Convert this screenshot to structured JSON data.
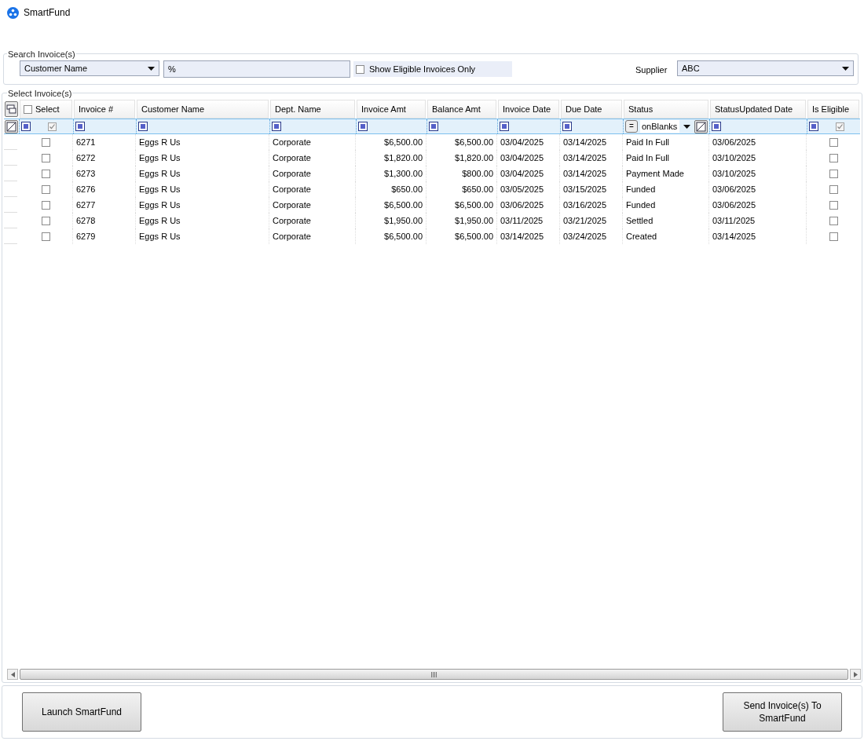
{
  "window": {
    "title": "SmartFund"
  },
  "search": {
    "title": "Search Invoice(s)",
    "field": "Customer Name",
    "value": "%",
    "eligible_only": {
      "label": "Show Eligible Invoices Only",
      "checked": false
    },
    "supplier_label": "Supplier",
    "supplier": "ABC"
  },
  "grid": {
    "title": "Select Invoice(s)",
    "select_all": {
      "label": "Select",
      "checked": false
    },
    "columns": [
      {
        "label": "Invoice #",
        "kind": "text"
      },
      {
        "label": "Customer Name",
        "kind": "text"
      },
      {
        "label": "Dept. Name",
        "kind": "text"
      },
      {
        "label": "Invoice Amt",
        "kind": "amount"
      },
      {
        "label": "Balance Amt",
        "kind": "amount"
      },
      {
        "label": "Invoice Date",
        "kind": "text"
      },
      {
        "label": "Due Date",
        "kind": "text"
      },
      {
        "label": "Status",
        "kind": "text"
      },
      {
        "label": "StatusUpdated Date",
        "kind": "text"
      }
    ],
    "eligible_label": "Is Eligible",
    "filter": {
      "select_checked": true,
      "status_operator": "=",
      "status_text": "onBlanks",
      "eligible_checked": true
    },
    "rows": [
      {
        "selected": false,
        "cells": [
          "6271",
          "Eggs R Us",
          "Corporate",
          "$6,500.00",
          "$6,500.00",
          "03/04/2025",
          "03/14/2025",
          "Paid In Full",
          "03/06/2025"
        ],
        "eligible": false
      },
      {
        "selected": false,
        "cells": [
          "6272",
          "Eggs R Us",
          "Corporate",
          "$1,820.00",
          "$1,820.00",
          "03/04/2025",
          "03/14/2025",
          "Paid In Full",
          "03/10/2025"
        ],
        "eligible": false
      },
      {
        "selected": false,
        "cells": [
          "6273",
          "Eggs R Us",
          "Corporate",
          "$1,300.00",
          "$800.00",
          "03/04/2025",
          "03/14/2025",
          "Payment Made",
          "03/10/2025"
        ],
        "eligible": false
      },
      {
        "selected": false,
        "cells": [
          "6276",
          "Eggs R Us",
          "Corporate",
          "$650.00",
          "$650.00",
          "03/05/2025",
          "03/15/2025",
          "Funded",
          "03/06/2025"
        ],
        "eligible": false
      },
      {
        "selected": false,
        "cells": [
          "6277",
          "Eggs R Us",
          "Corporate",
          "$6,500.00",
          "$6,500.00",
          "03/06/2025",
          "03/16/2025",
          "Funded",
          "03/06/2025"
        ],
        "eligible": false
      },
      {
        "selected": false,
        "cells": [
          "6278",
          "Eggs R Us",
          "Corporate",
          "$1,950.00",
          "$1,950.00",
          "03/11/2025",
          "03/21/2025",
          "Settled",
          "03/11/2025"
        ],
        "eligible": false
      },
      {
        "selected": false,
        "cells": [
          "6279",
          "Eggs R Us",
          "Corporate",
          "$6,500.00",
          "$6,500.00",
          "03/14/2025",
          "03/24/2025",
          "Created",
          "03/14/2025"
        ],
        "eligible": false
      }
    ]
  },
  "buttons": [
    {
      "label": "Launch SmartFund"
    },
    {
      "label": "Send Invoice(s) To SmartFund"
    }
  ]
}
